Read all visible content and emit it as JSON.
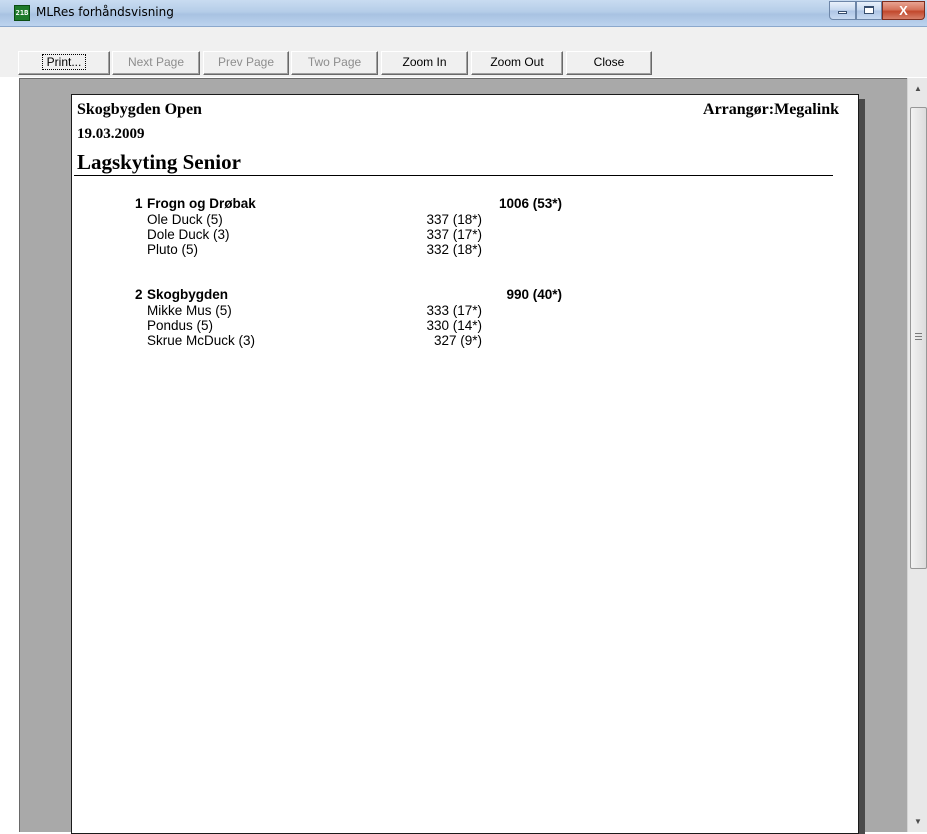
{
  "window": {
    "title": "MLRes forhåndsvisning",
    "app_icon_text": "21B",
    "controls": {
      "close_glyph": "X"
    }
  },
  "toolbar": {
    "buttons": [
      {
        "label": "Print...",
        "enabled": true
      },
      {
        "label": "Next Page",
        "enabled": false
      },
      {
        "label": "Prev Page",
        "enabled": false
      },
      {
        "label": "Two Page",
        "enabled": false
      },
      {
        "label": "Zoom In",
        "enabled": true
      },
      {
        "label": "Zoom Out",
        "enabled": true
      },
      {
        "label": "Close",
        "enabled": true
      }
    ]
  },
  "report": {
    "event_name": "Skogbygden Open",
    "organizer": "Arrangør:Megalink",
    "date": "19.03.2009",
    "section_title": "Lagskyting Senior",
    "teams": [
      {
        "rank": "1",
        "name": "Frogn og Drøbak",
        "score": "1006 (53*)",
        "members": [
          {
            "name": "Ole Duck (5)",
            "score": "337 (18*)"
          },
          {
            "name": "Dole Duck (3)",
            "score": "337 (17*)"
          },
          {
            "name": "Pluto (5)",
            "score": "332 (18*)"
          }
        ]
      },
      {
        "rank": "2",
        "name": "Skogbygden",
        "score": "990 (40*)",
        "members": [
          {
            "name": "Mikke Mus (5)",
            "score": "333 (17*)"
          },
          {
            "name": "Pondus (5)",
            "score": "330 (14*)"
          },
          {
            "name": "Skrue McDuck (3)",
            "score": "327 (9*)"
          }
        ]
      }
    ]
  },
  "scrollbar": {
    "position_fraction": 0.0,
    "visible_fraction": 0.65
  },
  "colors": {
    "titlebar": "#b5cde8",
    "close_button": "#c2482c",
    "app_icon": "#1f7a2b",
    "preview_background": "#a9a9a9",
    "disabled_text": "#8d8d8d"
  }
}
